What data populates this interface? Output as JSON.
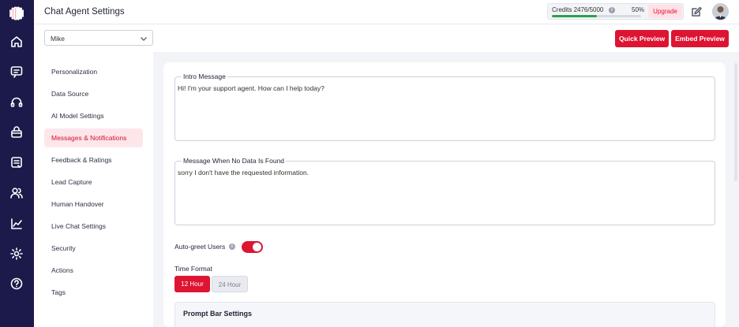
{
  "header": {
    "title": "Chat Agent Settings",
    "credits": {
      "label": "Credits 2476/5000",
      "percent_text": "50%",
      "usage_fraction": 0.5,
      "upgrade_label": "Upgrade"
    }
  },
  "agent_select": {
    "value": "Mike"
  },
  "actions": {
    "quick_preview": "Quick Preview",
    "embed_preview": "Embed Preview"
  },
  "rail_icons": [
    "home-icon",
    "chat-icon",
    "headset-icon",
    "bag-icon",
    "inbox-icon",
    "users-icon",
    "analytics-icon",
    "gear-icon",
    "help-icon"
  ],
  "sidenav": {
    "items": [
      {
        "label": "Personalization"
      },
      {
        "label": "Data Source"
      },
      {
        "label": "AI Model Settings"
      },
      {
        "label": "Messages & Notifications",
        "active": true
      },
      {
        "label": "Feedback & Ratings"
      },
      {
        "label": "Lead Capture"
      },
      {
        "label": "Human Handover"
      },
      {
        "label": "Live Chat Settings"
      },
      {
        "label": "Security"
      },
      {
        "label": "Actions"
      },
      {
        "label": "Tags"
      }
    ]
  },
  "form": {
    "intro": {
      "label": "Intro Message",
      "value": "Hi! I'm your support agent. How can I help today?"
    },
    "no_data": {
      "label": "Message When No Data Is Found",
      "value": "sorry I don't have the requested information."
    },
    "auto_greet": {
      "label": "Auto-greet Users",
      "enabled": true
    },
    "time_format": {
      "label": "Time Format",
      "options": [
        "12 Hour",
        "24 Hour"
      ],
      "selected": "12 Hour"
    },
    "prompt_bar": {
      "title": "Prompt Bar Settings"
    }
  },
  "colors": {
    "accent": "#dd1533",
    "rail": "#1b1a4a",
    "credit_bar": "#2ca24f"
  }
}
